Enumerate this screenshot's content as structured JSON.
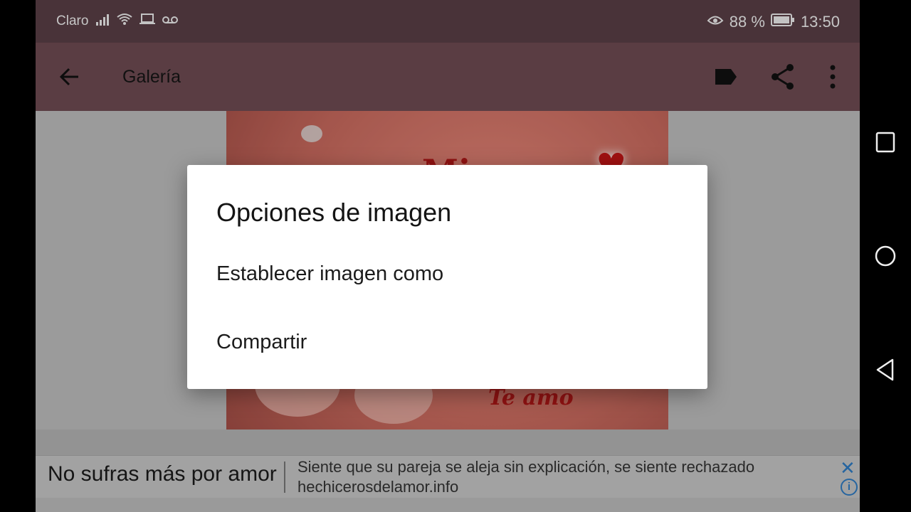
{
  "status_bar": {
    "carrier": "Claro",
    "battery_percent": "88 %",
    "time": "13:50",
    "icons": [
      "signal-icon",
      "wifi-icon",
      "laptop-icon",
      "voicemail-icon",
      "eye-icon",
      "battery-icon"
    ]
  },
  "app_bar": {
    "title": "Galería",
    "actions": [
      "label-icon",
      "share-icon",
      "more-vert-icon"
    ]
  },
  "dialog": {
    "title": "Opciones de imagen",
    "options": [
      "Establecer imagen como",
      "Compartir"
    ]
  },
  "ad": {
    "headline": "No sufras más por amor",
    "description_line1": "Siente que su pareja se aleja sin explicación, se siente rechazado",
    "description_line2": "hechicerosdelamor.info"
  },
  "photo": {
    "caption": "Te amo",
    "partial_text": "Mi ..."
  },
  "colors": {
    "status_bar": "#5a3f46",
    "app_bar": "#6e4b52",
    "ad_icon": "#2f7cc4"
  },
  "nav_bar": [
    "recent-apps-icon",
    "home-icon",
    "back-nav-icon"
  ]
}
